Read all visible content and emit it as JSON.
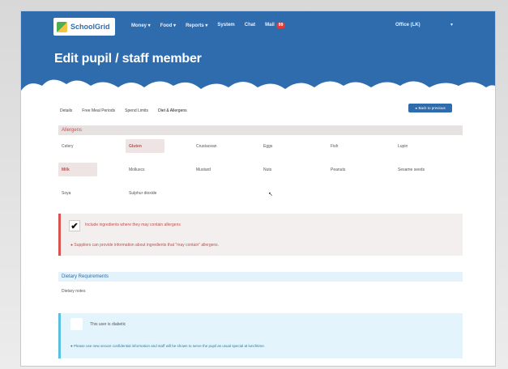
{
  "header": {
    "logo_text": "SchoolGrid",
    "nav": [
      "Money",
      "Food",
      "Reports",
      "System",
      "Chat",
      "Mail"
    ],
    "mail_badge": "99",
    "office": "Office (LK)",
    "page_title": "Edit pupil / staff member"
  },
  "tabs": [
    "Details",
    "Free Meal Periods",
    "Spend Limits",
    "Diet & Allergens"
  ],
  "back_button": "Back to previous",
  "allergens": {
    "title": "Allergens",
    "items": [
      {
        "label": "Celery",
        "selected": false
      },
      {
        "label": "Gluten",
        "selected": true
      },
      {
        "label": "Crustacean",
        "selected": false
      },
      {
        "label": "Eggs",
        "selected": false
      },
      {
        "label": "Fish",
        "selected": false
      },
      {
        "label": "Lupin",
        "selected": false
      },
      {
        "label": "Milk",
        "selected": true
      },
      {
        "label": "Molluscs",
        "selected": false
      },
      {
        "label": "Mustard",
        "selected": false
      },
      {
        "label": "Nuts",
        "selected": false
      },
      {
        "label": "Peanuts",
        "selected": false
      },
      {
        "label": "Sesame seeds",
        "selected": false
      },
      {
        "label": "Soya",
        "selected": false
      },
      {
        "label": "Sulphur dioxide",
        "selected": false
      }
    ],
    "include_label": "Include ingredients where they may contain allergens",
    "note": "Suppliers can provide information about ingredients that \"may contain\" allergens."
  },
  "dietary": {
    "title": "Dietary Requirements",
    "notes_label": "Dietary notes",
    "toggle_label": "This user is diabetic",
    "info_note": "Please use new secure confidential information and staff will be shown to serve the pupil as usual special at lunchtime."
  },
  "colors": {
    "header_blue": "#2f6cad",
    "allergen_red": "#c0504d",
    "info_blue": "#5bc0de"
  }
}
